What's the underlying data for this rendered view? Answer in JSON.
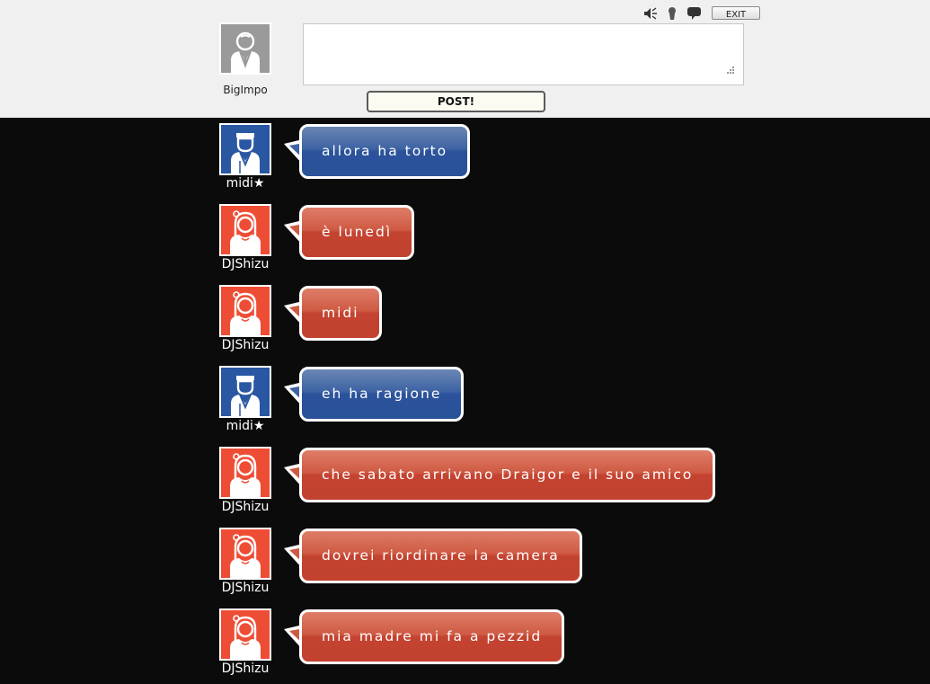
{
  "toolbar": {
    "icons": [
      "speaker-mute-icon",
      "user-silhouette-icon",
      "speech-bubble-icon"
    ],
    "exit_label": "EXIT"
  },
  "composer": {
    "username": "BigImpo",
    "avatar_icon": "gray-male-avatar",
    "input_value": "",
    "post_label": "POST!"
  },
  "colors": {
    "header_bg": "#f0f0f0",
    "log_bg": "#0b0b0b",
    "blue_user": "#2a57a2",
    "red_user": "#ee4d35"
  },
  "messages": [
    {
      "user": "midi★",
      "color": "blue",
      "avatar_icon": "blue-male-headband-avatar",
      "text": "allora ha torto"
    },
    {
      "user": "DJShizu",
      "color": "red",
      "avatar_icon": "red-female-avatar",
      "text": "è lunedì"
    },
    {
      "user": "DJShizu",
      "color": "red",
      "avatar_icon": "red-female-avatar",
      "text": "midi"
    },
    {
      "user": "midi★",
      "color": "blue",
      "avatar_icon": "blue-male-headband-avatar",
      "text": "eh ha ragione"
    },
    {
      "user": "DJShizu",
      "color": "red",
      "avatar_icon": "red-female-avatar",
      "text": "che sabato arrivano Draigor e il suo amico"
    },
    {
      "user": "DJShizu",
      "color": "red",
      "avatar_icon": "red-female-avatar",
      "text": "dovrei riordinare la camera"
    },
    {
      "user": "DJShizu",
      "color": "red",
      "avatar_icon": "red-female-avatar",
      "text": "mia madre mi fa a pezzid"
    }
  ]
}
